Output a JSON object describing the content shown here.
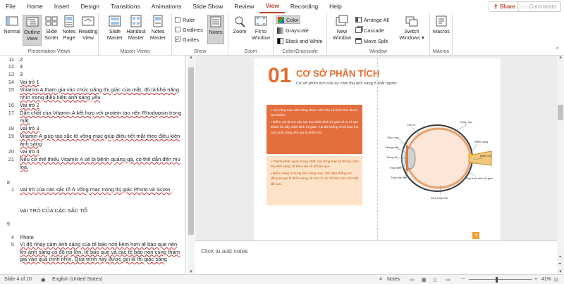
{
  "tabs": [
    "File",
    "Home",
    "Insert",
    "Design",
    "Transitions",
    "Animations",
    "Slide Show",
    "Review",
    "View",
    "Recording",
    "Help"
  ],
  "share": "Share",
  "comments": "Comments",
  "groups": {
    "presentation_views": "Presentation Views",
    "master_views": "Master Views",
    "show": "Show",
    "zoom": "Zoom",
    "color": "Color/Grayscale",
    "window": "Window",
    "macros": "Macros"
  },
  "buttons": {
    "normal": "Normal",
    "outline1": "Outline",
    "outline2": "View",
    "slide_sorter1": "Slide",
    "slide_sorter2": "Sorter",
    "notes_page1": "Notes",
    "notes_page2": "Page",
    "reading1": "Reading",
    "reading2": "View",
    "slide_master1": "Slide",
    "slide_master2": "Master",
    "handout1": "Handout",
    "handout2": "Master",
    "notes_master1": "Notes",
    "notes_master2": "Master",
    "ruler": "Ruler",
    "gridlines": "Gridlines",
    "guides": "Guides",
    "notes": "Notes",
    "zoom": "Zoom",
    "fit1": "Fit to",
    "fit2": "Window",
    "color": "Color",
    "grayscale": "Grayscale",
    "bw": "Black and White",
    "new_window1": "New",
    "new_window2": "Window",
    "arrange": "Arrange All",
    "cascade": "Cascade",
    "move_split": "Move Split",
    "switch1": "Switch",
    "switch2": "Windows",
    "macros": "Macros"
  },
  "outline": [
    {
      "n": "11",
      "t": "2"
    },
    {
      "n": "12",
      "t": "4"
    },
    {
      "n": "13",
      "t": "3"
    },
    {
      "n": "14",
      "t": "Vai trò 1"
    },
    {
      "n": "15",
      "t": "Vitiamin A tham gia vào chức năng thị giác của mắt, đó là khả năng nhìn trong điều kiện ánh sáng yếu"
    },
    {
      "n": "16",
      "t": "Vai trò 2"
    },
    {
      "n": "17",
      "t": "Dẫn chất của Vitamin A kết hợp với protein tạo nên Rhodopsin trong mắt."
    },
    {
      "n": "18",
      "t": "Vai trò 3"
    },
    {
      "n": "19",
      "t": "Vitamin A giúp tạo sắc tố võng mạc giúp điều tiết mắt theo điều kiện ánh sáng"
    },
    {
      "n": "20",
      "t": "Vai trò 4"
    },
    {
      "n": "21",
      "t": "Nếu cơ thể thiếu Vitamin A sẽ bị bệnh quáng gà, có thể dẫn đến mù lòa."
    },
    {
      "n": "8",
      "t": ""
    },
    {
      "n": "1",
      "t": "Vai trò của các sắc tố ở võng mạc trong        thị giác Photo và Scoto."
    },
    {
      "n": "",
      "t": "VAI TRÒ CỦA CÁC SẮC TỐ"
    },
    {
      "n": "9",
      "t": ""
    },
    {
      "n": "4",
      "t": "Photo"
    },
    {
      "n": "5",
      "t": "Vì độ nhạy cảm ánh sáng của tế bào nón kém hơn tế bào que nên khi ánh sáng có độ rọi lớn, tế bào que và các tế bào nón cùng tham gia vào quá trình nhìn. Quá trình này được gọi là thị giác sáng"
    }
  ],
  "slide": {
    "number": "01",
    "title": "CƠ SỞ PHÂN TÍCH",
    "subtitle": "Cơ sở phân tích của sự cảm thụ ánh sáng ở mắt người.",
    "box1": [
      "Tại võng mạc ánh sáng được cảm thụ và hình ảnh được tạo thành.",
      "Điểm mù là nơi các sợi trục thần kinh thị giác đi ra và tạo thành bó dây thần kinh thị giác. Tại đó không có tế bào thụ cảm ánh sáng nên gọi là điểm mù."
    ],
    "box2": [
      "Thành phần quan trọng nhất của võng mạc là tế bào cảm thụ ánh sáng: tế bào nón và tế bào que.",
      "Điểm vàng là trung tâm võng mạc, đối diện thẳng với đồng tử gọi là điểm vàng, là nơi có các tế bào nón với mật độ cao."
    ],
    "labels": {
      "thuy_tinh": "Thể mi",
      "vong_mac": "Võng mạc",
      "giac_mac": "Giác mạc",
      "mong_mat": "Mống mắt",
      "dong_tu": "Đồng tử",
      "thuy_dich": "Thủy dịch",
      "thuy_tinh_the": "Thủy tinh thể",
      "diem_vang": "Điểm vàng",
      "diem_mu": "Điểm mù",
      "day_than_kinh": "Dây thần kinh thị giác",
      "dich_thuy_tinh": "Dịch thủy tinh"
    },
    "page": "4"
  },
  "notes_placeholder": "Click to add notes",
  "status": {
    "slide": "Slide 4 of 10",
    "lang": "English (United States)",
    "notes": "Notes",
    "zoom": "41%"
  },
  "colors": {
    "accent": "#e36c2d",
    "brand": "#b7472a"
  }
}
